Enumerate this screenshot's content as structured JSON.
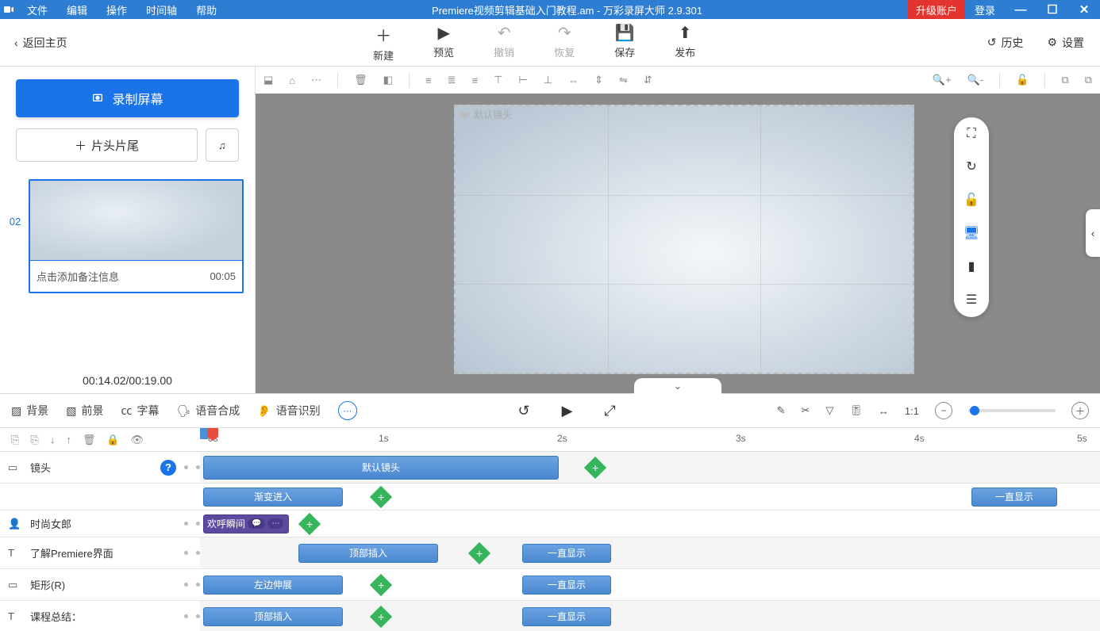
{
  "titlebar": {
    "menus": [
      "文件",
      "编辑",
      "操作",
      "时间轴",
      "帮助"
    ],
    "title": "Premiere视频剪辑基础入门教程.am - 万彩录屏大师 2.9.301",
    "upgrade": "升级账户",
    "login": "登录"
  },
  "toptool": {
    "back": "返回主页",
    "actions": {
      "new": "新建",
      "preview": "预览",
      "undo": "撤销",
      "redo": "恢复",
      "save": "保存",
      "publish": "发布"
    },
    "history": "历史",
    "settings": "设置"
  },
  "leftpanel": {
    "record": "录制屏幕",
    "titles": "片头片尾",
    "slide_num": "02",
    "slide_note": "点击添加备注信息",
    "slide_dur": "00:05",
    "time": "00:14.02/00:19.00"
  },
  "canvas": {
    "default_lens": "默认镜头"
  },
  "tl_tabs": {
    "bg": "背景",
    "fg": "前景",
    "subtitle": "字幕",
    "tts": "语音合成",
    "asr": "语音识别"
  },
  "ruler": {
    "ticks": [
      "0s",
      "1s",
      "2s",
      "3s",
      "4s",
      "5s"
    ]
  },
  "tracks": {
    "lens": "镜头",
    "fashion": "时尚女郎",
    "premiere": "了解Premiere界面",
    "rect": "矩形(R)",
    "summary": "课程总结：",
    "clip_default": "默认镜头",
    "clip_fadein": "渐变进入",
    "clip_showalways": "一直显示",
    "clip_cheer": "欢呼瞬间",
    "clip_topinsert": "顶部插入",
    "clip_leftextend": "左边伸展"
  }
}
